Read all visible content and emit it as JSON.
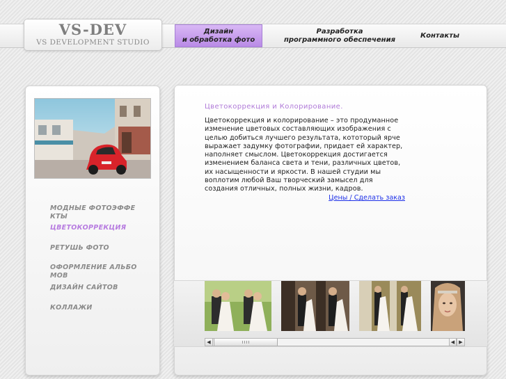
{
  "logo": {
    "title": "VS-DEV",
    "subtitle": "VS DEVELOPMENT STUDIO"
  },
  "nav": [
    {
      "line1": "Дизайн",
      "line2": "и обработка фото",
      "active": true
    },
    {
      "line1": "Разработка",
      "line2": "программного обеспечения",
      "active": false
    },
    {
      "line1": "Контакты",
      "line2": "",
      "active": false
    }
  ],
  "sidebar": {
    "photo_icon": "red-beetle-car-photo",
    "items": [
      {
        "label": "МОДНЫЕ ФОТОЭФФЕКТЫ",
        "active": false
      },
      {
        "label": "ЦВЕТОКОРРЕКЦИЯ",
        "active": true
      },
      {
        "label": "РЕТУШЬ ФОТО",
        "active": false
      },
      {
        "label": "ОФОРМЛЕНИЕ АЛЬБОМОВ",
        "active": false
      },
      {
        "label": "ДИЗАЙН САЙТОВ",
        "active": false
      },
      {
        "label": "КОЛЛАЖИ",
        "active": false
      }
    ]
  },
  "content": {
    "title": "Цветокоррекция и Колорирование.",
    "body": "Цветокоррекция и колорирование – это продуманное изменение цветовых составляющих изображения с целью добиться лучшего результата, кототорый ярче выражает задумку фотографии, придает ей характер, наполняет смыслом. Цветокоррекция достигается изменением баланса света и тени, различных цветов, их насыщенности и яркости. В нашей студии мы воплотим любой Ваш творческий замысел для создания отличных, полных жизни, кадров.",
    "link": "Цены / Сделать заказ"
  },
  "gallery": {
    "thumbs": [
      "wedding-couple-photo",
      "wedding-church-photo",
      "wedding-garden-photo",
      "portrait-woman-photo"
    ]
  },
  "colors": {
    "accent": "#b77be0",
    "nav_active": "#c9a0ee",
    "link": "#1b2ee8"
  }
}
